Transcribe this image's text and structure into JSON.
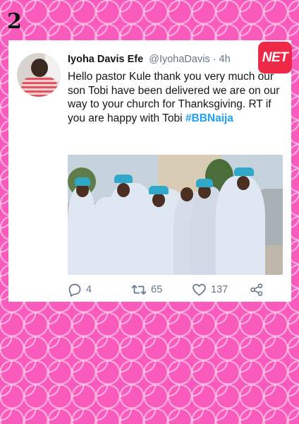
{
  "slide": {
    "number": "2"
  },
  "tweet": {
    "author_name": "Iyoha Davis Efe",
    "handle": "@IyohaDavis",
    "time": "· 4h",
    "text_main": "Hello pastor Kule thank you very much our son Tobi have been delivered we are on our way to your church for Thanksgiving. RT if you are happy with Tobi ",
    "hashtag": "#BBNaija"
  },
  "badge": {
    "label": "NET",
    "color": "#ee2947"
  },
  "actions": {
    "replies": "4",
    "retweets": "65",
    "likes": "137"
  },
  "icons": {
    "reply": "reply-icon",
    "retweet": "retweet-icon",
    "like": "heart-icon",
    "share": "share-icon"
  },
  "colors": {
    "background": "#f95bbd",
    "accent": "#1da1f2",
    "muted": "#657786"
  }
}
